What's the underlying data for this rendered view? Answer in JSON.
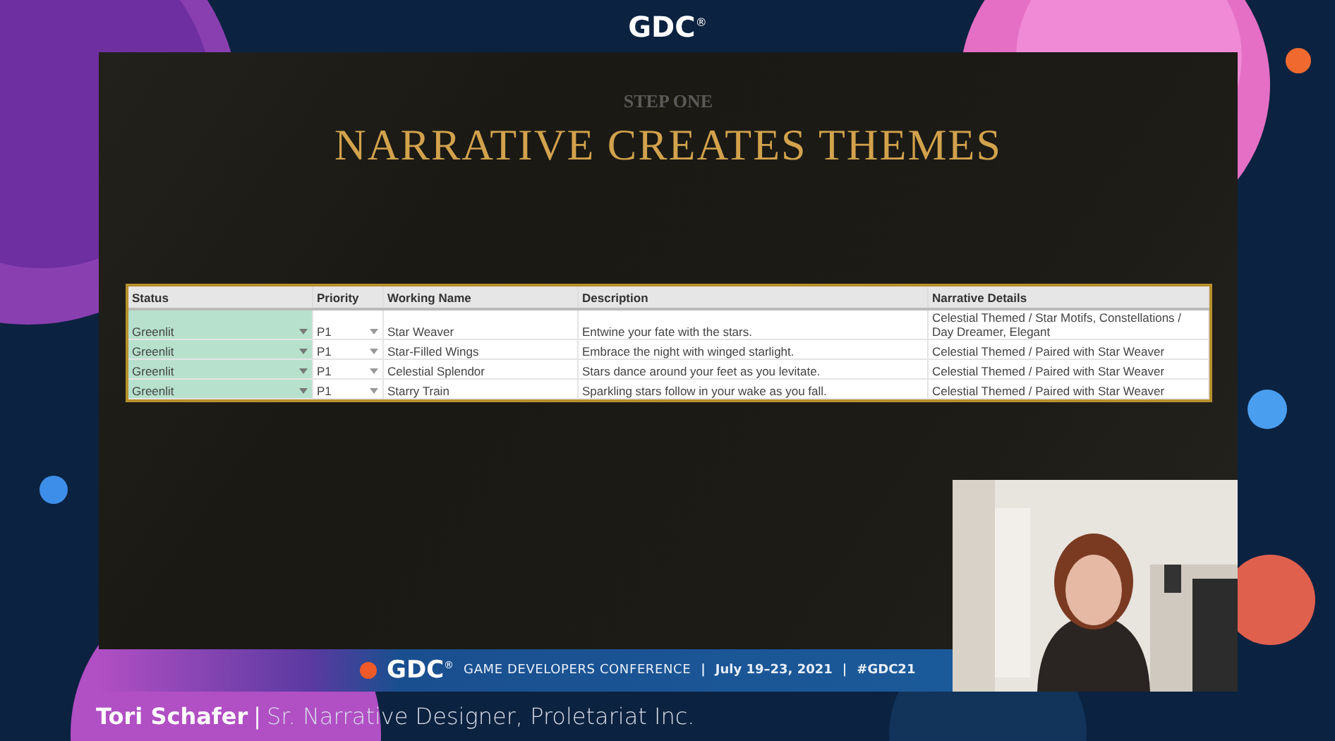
{
  "header": {
    "logo": "GDC$^{®}$"
  },
  "slide": {
    "eyebrow": "STEP ONE",
    "title": "NARRATIVE CREATES THEMES",
    "table": {
      "columns": [
        "Status",
        "Priority",
        "Working Name",
        "Description",
        "Narrative Details"
      ],
      "rows": [
        {
          "status": "Greenlit",
          "priority": "P1",
          "name": "Star Weaver",
          "description": "Entwine your fate with the stars.",
          "details": "Celestial Themed / Star Motifs, Constellations / Day Dreamer, Elegant"
        },
        {
          "status": "Greenlit",
          "priority": "P1",
          "name": "Star-Filled Wings",
          "description": "Embrace the night with winged starlight.",
          "details": "Celestial Themed / Paired with Star Weaver"
        },
        {
          "status": "Greenlit",
          "priority": "P1",
          "name": "Celestial Splendor",
          "description": "Stars dance around your feet as you levitate.",
          "details": "Celestial Themed / Paired with Star Weaver"
        },
        {
          "status": "Greenlit",
          "priority": "P1",
          "name": "Starry Train",
          "description": "Sparkling stars follow in your wake as you fall.",
          "details": "Celestial Themed / Paired with Star Weaver"
        }
      ]
    }
  },
  "banner": {
    "logo": "GDC$^{®}$",
    "items": [
      "GAME DEVELOPERS CONFERENCE",
      "|",
      "July 19–23, 2021",
      "|",
      "#GDC21"
    ]
  },
  "speaker": {
    "name": "Tori Schafer",
    "separator": "|",
    "role": "Sr. Narrative Designer, Proletariat Inc."
  }
}
